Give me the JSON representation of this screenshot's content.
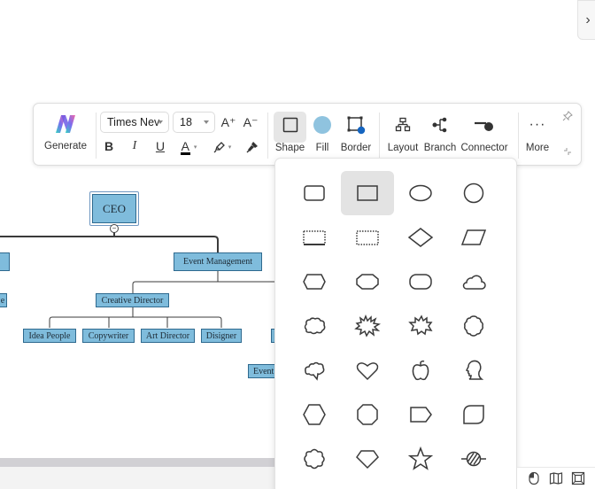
{
  "sidebar_toggle": {
    "icon": "chevron-right-icon",
    "glyph": "›"
  },
  "toolbar": {
    "generate_label": "Generate",
    "font_family": "Times Nev",
    "font_size": "18",
    "increase_font_glyph": "A⁺",
    "decrease_font_glyph": "A⁻",
    "bold_glyph": "B",
    "italic_glyph": "I",
    "underline_glyph": "U",
    "font_color_glyph": "A",
    "font_color": "#000000",
    "shape_label": "Shape",
    "fill_label": "Fill",
    "fill_color": "#8fc3df",
    "border_label": "Border",
    "border_accent": "#1565c0",
    "layout_label": "Layout",
    "branch_label": "Branch",
    "connector_label": "Connector",
    "more_label": "More",
    "more_glyph": "···"
  },
  "diagram": {
    "nodes": {
      "ceo": "CEO",
      "event_management": "Event Management",
      "creative_director": "Creative Director",
      "idea_people": "Idea People",
      "copywriter": "Copywriter",
      "art_director": "Art Director",
      "designer": "Disigner",
      "event_partial": "Event",
      "left_partial_1": "",
      "left_partial_2": "e"
    },
    "collapse_glyph": "−"
  },
  "shape_panel": {
    "selected": "rectangle",
    "shapes": [
      "rounded-rectangle",
      "rectangle",
      "ellipse",
      "circle",
      "dotted-rectangle-underline",
      "dotted-rectangle",
      "diamond",
      "parallelogram",
      "hexagon-flat",
      "octagon-rounded",
      "stadium",
      "cloud",
      "cloud-bumpy",
      "explosion-1",
      "explosion-2",
      "scalloped-circle",
      "brain-bubble",
      "heart",
      "apple",
      "head-profile",
      "hexagon",
      "octagon",
      "pentagon-tag",
      "leaf-rect",
      "quatrefoil",
      "diamond-gem",
      "star",
      "no-symbol"
    ]
  },
  "status_bar": {
    "icons": [
      "mouse-icon",
      "map-icon",
      "fit-screen-icon"
    ]
  }
}
